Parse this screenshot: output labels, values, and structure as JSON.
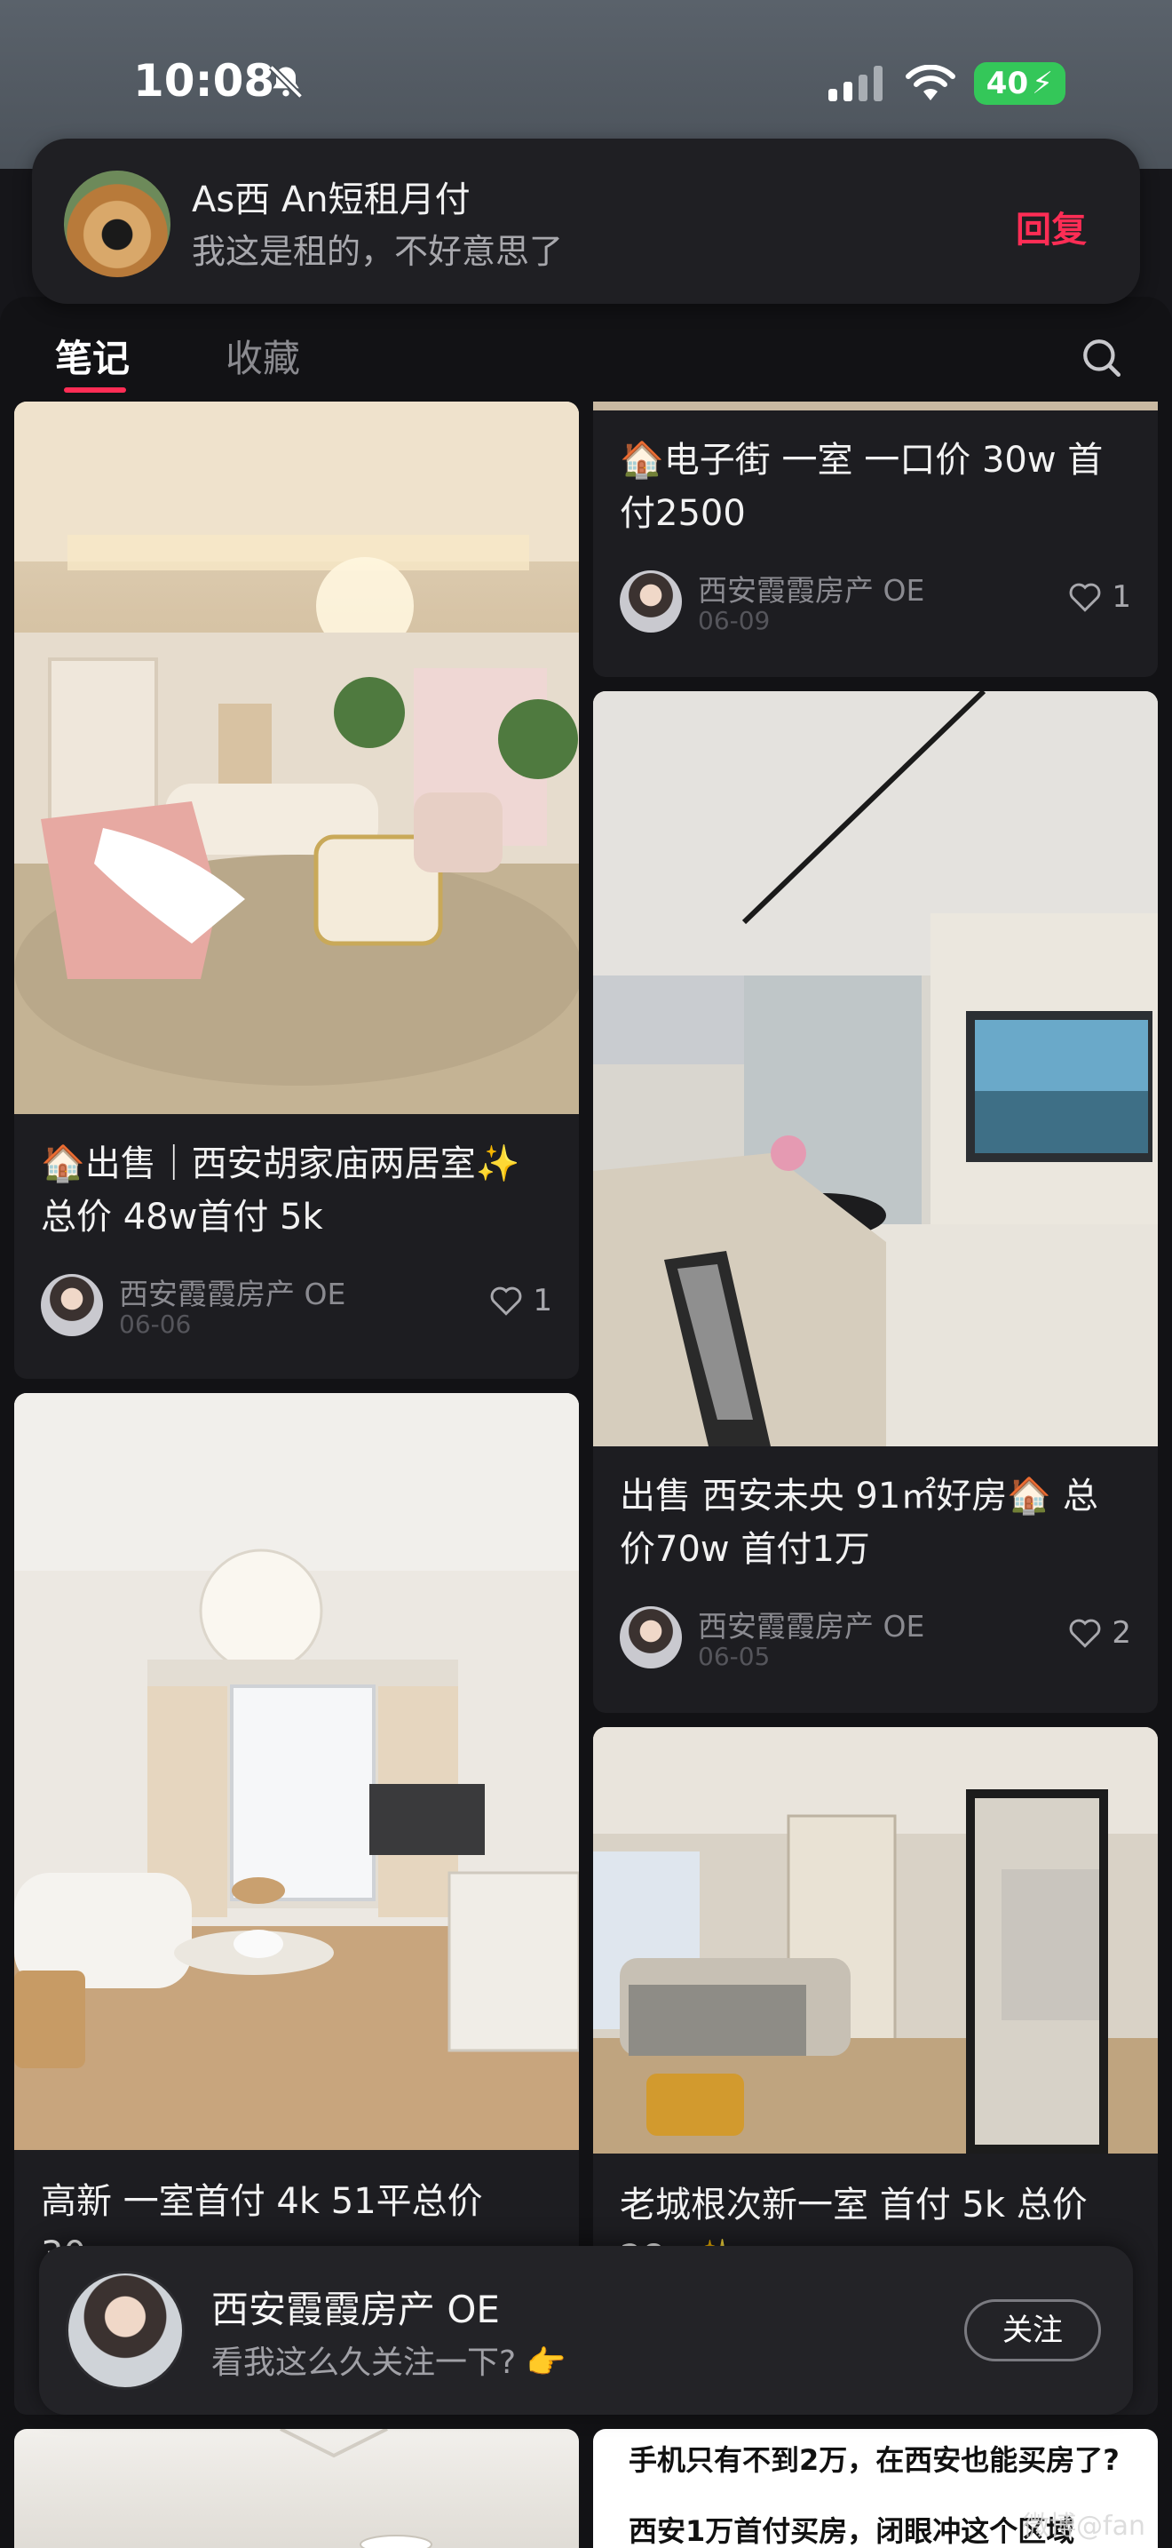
{
  "status_bar": {
    "time": "10:08",
    "battery": "40",
    "icons": [
      "bell-slash-icon",
      "signal-icon",
      "wifi-icon",
      "battery-charging-icon"
    ]
  },
  "notification": {
    "title": "As西 An短租月付",
    "message": "我这是租的，不好意思了",
    "reply_label": "回复"
  },
  "tabs": [
    {
      "label": "笔记",
      "active": true
    },
    {
      "label": "收藏",
      "active": false
    }
  ],
  "cards": [
    {
      "title": "🏠出售｜西安胡家庙两居室✨总价 48w首付 5k",
      "author": "西安霞霞房产 OE",
      "date": "06-06",
      "likes": "1"
    },
    {
      "title": "🏠电子街 一室 一口价 30w 首付2500",
      "author": "西安霞霞房产 OE",
      "date": "06-09",
      "likes": "1"
    },
    {
      "title": "出售 西安未央 91㎡好房🏠 总价70w 首付1万",
      "author": "西安霞霞房产 OE",
      "date": "06-05",
      "likes": "2"
    },
    {
      "title": "高新 一室首付 4k 51平总价 30w",
      "author": "西安霞霞房产 OE",
      "date": "",
      "likes": ""
    },
    {
      "title": "老城根次新一室 首付 5k 总价 28w✨",
      "author": "西安霞霞房产 OE",
      "date": "",
      "likes": ""
    },
    {
      "title": "手机只有不到2万，在西安也能买房了?",
      "subtitle": "西安1万首付买房，闭眼冲这个区域"
    }
  ],
  "follow_banner": {
    "name": "西安霞霞房产 OE",
    "message": "看我这么久关注一下? 👉",
    "button": "关注"
  },
  "watermark": "微博@fan",
  "colors": {
    "accent": "#ff2d55",
    "background": "#121215",
    "card": "#1d1d21"
  }
}
